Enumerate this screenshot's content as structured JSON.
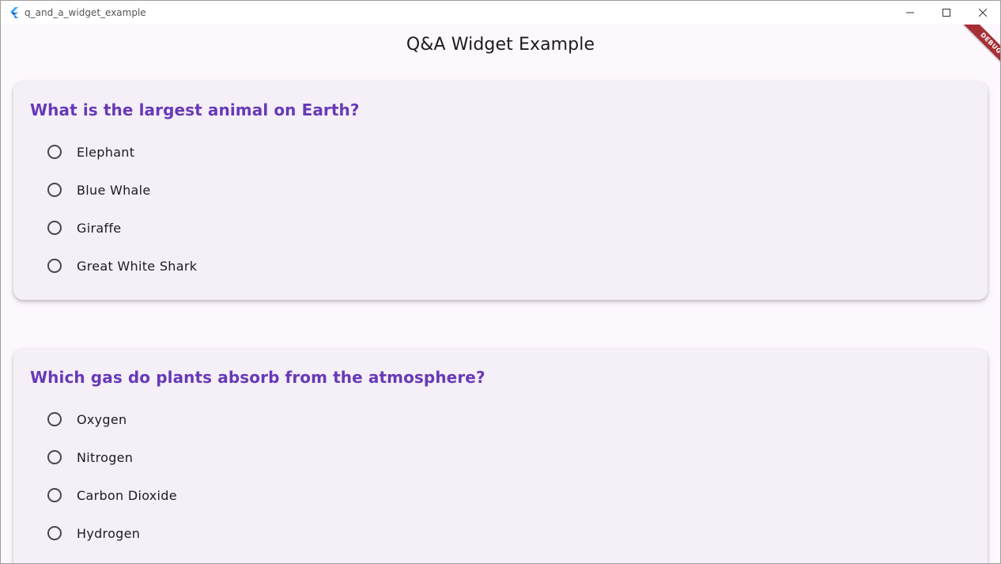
{
  "window": {
    "title": "q_and_a_widget_example"
  },
  "appbar": {
    "title": "Q&A Widget Example",
    "debug_banner": "DEBUG"
  },
  "colors": {
    "question": "#673ab7",
    "background": "#fdf7fe",
    "card": "#f5eff7",
    "debug_banner": "#a62f35"
  },
  "questions": [
    {
      "text": "What is the largest animal on Earth?",
      "options": [
        "Elephant",
        "Blue Whale",
        "Giraffe",
        "Great White Shark"
      ],
      "selected": null
    },
    {
      "text": "Which gas do plants absorb from the atmosphere?",
      "options": [
        "Oxygen",
        "Nitrogen",
        "Carbon Dioxide",
        "Hydrogen"
      ],
      "selected": null
    }
  ]
}
